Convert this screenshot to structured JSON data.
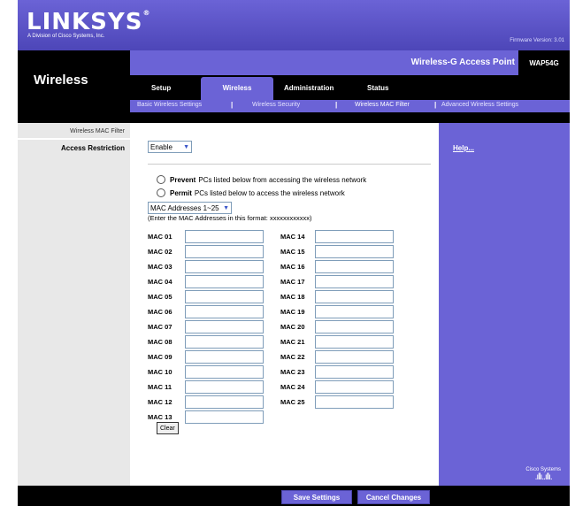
{
  "header": {
    "logo": "LINKSYS",
    "logo_sub": "A Division of Cisco Systems, Inc.",
    "firmware": "Firmware Version: 3.01",
    "section": "Wireless",
    "product": "Wireless-G Access Point",
    "model": "WAP54G"
  },
  "tabs": [
    {
      "label": "Setup"
    },
    {
      "label": "Wireless"
    },
    {
      "label": "Administration"
    },
    {
      "label": "Status"
    }
  ],
  "subtabs": [
    {
      "label": "Basic Wireless Settings"
    },
    {
      "label": "Wireless Security"
    },
    {
      "label": "Wireless MAC Filter"
    },
    {
      "label": "Advanced Wireless Settings"
    }
  ],
  "left": {
    "section_label": "Wireless MAC Filter",
    "field_label": "Access Restriction"
  },
  "form": {
    "enable_value": "Enable",
    "prevent_bold": "Prevent",
    "prevent_text": "PCs listed below from accessing the wireless network",
    "permit_bold": "Permit",
    "permit_text": "PCs listed below to access the wireless network",
    "range_value": "MAC Addresses 1~25",
    "format_note": "(Enter the MAC Addresses in this format: xxxxxxxxxxxx)",
    "mac_left": [
      "MAC 01",
      "MAC 02",
      "MAC 03",
      "MAC 04",
      "MAC 05",
      "MAC 06",
      "MAC 07",
      "MAC 08",
      "MAC 09",
      "MAC 10",
      "MAC 11",
      "MAC 12",
      "MAC 13"
    ],
    "mac_right": [
      "MAC 14",
      "MAC 15",
      "MAC 16",
      "MAC 17",
      "MAC 18",
      "MAC 19",
      "MAC 20",
      "MAC 21",
      "MAC 22",
      "MAC 23",
      "MAC 24",
      "MAC 25"
    ],
    "clear_label": "Clear"
  },
  "right": {
    "help": "Help...",
    "cisco": "Cisco Systems"
  },
  "footer": {
    "save": "Save Settings",
    "cancel": "Cancel Changes"
  }
}
